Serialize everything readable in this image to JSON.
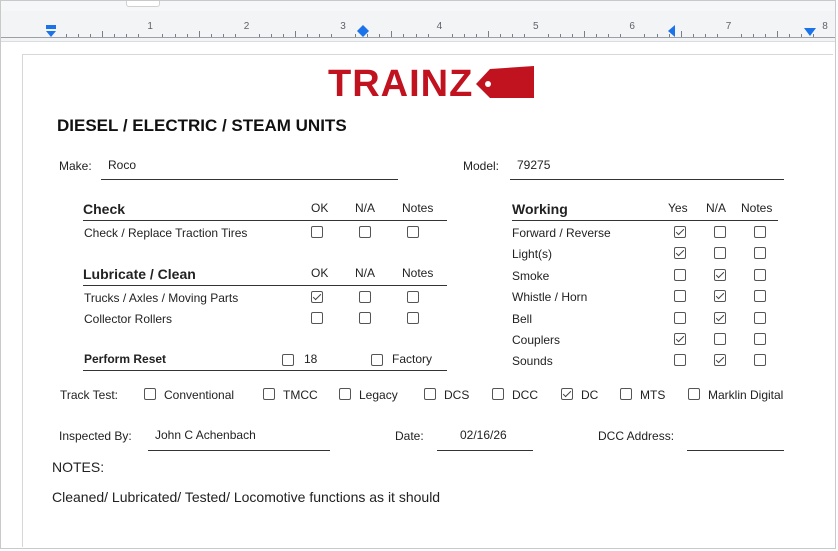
{
  "colors": {
    "brand": "#c1121f",
    "ink": "#222222",
    "ruler_bg": "#f3f4f6",
    "ruler_marker": "#1a73e8"
  },
  "ruler": {
    "numbers": [
      "1",
      "2",
      "3",
      "4",
      "5",
      "6",
      "7",
      "8"
    ]
  },
  "logo": {
    "text": "TRAINZ"
  },
  "title": "DIESEL / ELECTRIC / STEAM UNITS",
  "make": {
    "label": "Make:",
    "value": "Roco"
  },
  "model": {
    "label": "Model:",
    "value": "79275"
  },
  "check": {
    "heading": "Check",
    "columns": [
      "OK",
      "N/A",
      "Notes"
    ],
    "rows": [
      {
        "label": "Check / Replace Traction Tires",
        "checks": [
          false,
          false,
          false
        ]
      }
    ]
  },
  "lubricate": {
    "heading": "Lubricate / Clean",
    "columns": [
      "OK",
      "N/A",
      "Notes"
    ],
    "rows": [
      {
        "label": "Trucks / Axles / Moving Parts",
        "checks": [
          true,
          false,
          false
        ]
      },
      {
        "label": "Collector Rollers",
        "checks": [
          false,
          false,
          false
        ]
      }
    ]
  },
  "reset": {
    "heading": "Perform Reset",
    "options": [
      {
        "label": "18",
        "checked": false
      },
      {
        "label": "Factory",
        "checked": false
      }
    ]
  },
  "working": {
    "heading": "Working",
    "columns": [
      "Yes",
      "N/A",
      "Notes"
    ],
    "rows": [
      {
        "label": "Forward / Reverse",
        "checks": [
          true,
          false,
          false
        ]
      },
      {
        "label": "Light(s)",
        "checks": [
          true,
          false,
          false
        ]
      },
      {
        "label": "Smoke",
        "checks": [
          false,
          true,
          false
        ]
      },
      {
        "label": "Whistle / Horn",
        "checks": [
          false,
          true,
          false
        ]
      },
      {
        "label": "Bell",
        "checks": [
          false,
          true,
          false
        ]
      },
      {
        "label": "Couplers",
        "checks": [
          true,
          false,
          false
        ]
      },
      {
        "label": "Sounds",
        "checks": [
          false,
          true,
          false
        ]
      }
    ]
  },
  "track_test": {
    "label": "Track Test:",
    "options": [
      {
        "label": "Conventional",
        "checked": false
      },
      {
        "label": "TMCC",
        "checked": false
      },
      {
        "label": "Legacy",
        "checked": false
      },
      {
        "label": "DCS",
        "checked": false
      },
      {
        "label": "DCC",
        "checked": false
      },
      {
        "label": "DC",
        "checked": true
      },
      {
        "label": "MTS",
        "checked": false
      },
      {
        "label": "Marklin Digital",
        "checked": false
      }
    ]
  },
  "inspected_by": {
    "label": "Inspected By:",
    "value": "John C Achenbach"
  },
  "date": {
    "label": "Date:",
    "value": "02/16/26"
  },
  "dcc_address": {
    "label": "DCC Address:",
    "value": ""
  },
  "notes": {
    "label": "NOTES:",
    "text": "Cleaned/ Lubricated/ Tested/  Locomotive functions as it should"
  }
}
